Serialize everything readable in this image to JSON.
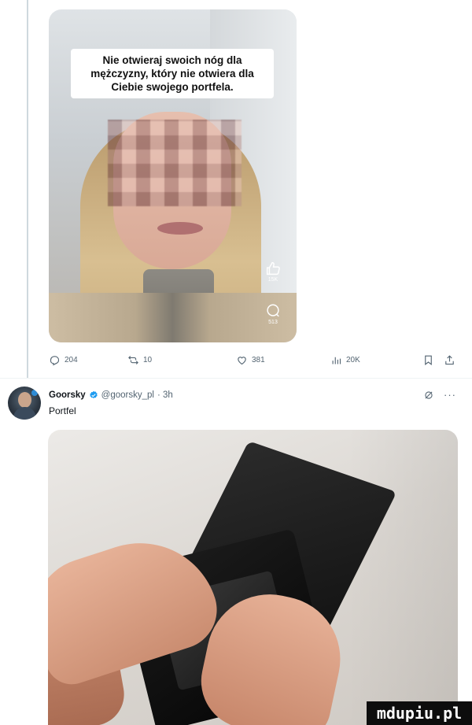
{
  "colors": {
    "accent": "#1d9bf0",
    "muted": "#536471",
    "text": "#0f1419",
    "divider": "#eff3f4"
  },
  "video": {
    "caption": "Nie otwieraj swoich nóg dla mężczyzny, który nie otwiera dla Ciebie swojego portfela.",
    "like_icon": "thumbs-up-icon",
    "like_count": "15K",
    "comment_icon": "comment-icon",
    "comment_count": "513"
  },
  "actions": {
    "replies": "204",
    "retweets": "10",
    "likes": "381",
    "views": "20K",
    "bookmark_icon": "bookmark-icon",
    "share_icon": "share-icon"
  },
  "tweet": {
    "name": "Goorsky",
    "handle": "@goorsky_pl",
    "time": "· 3h",
    "text": "Portfel",
    "verified": true
  },
  "watermark": "mdupiu.pl"
}
